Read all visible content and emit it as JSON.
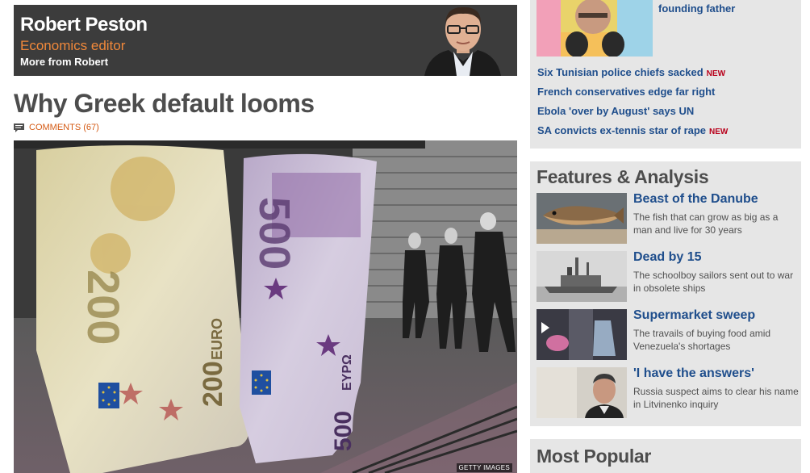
{
  "author": {
    "name": "Robert Peston",
    "role": "Economics editor",
    "more_label": "More from Robert"
  },
  "article": {
    "headline": "Why Greek default looms",
    "comments_label": "COMMENTS (67)",
    "image_credit": "GETTY IMAGES",
    "image_texts": {
      "note_left": "200",
      "note_right": "500",
      "euro": "EURO",
      "euro2": "EYPΩ"
    }
  },
  "sidebar": {
    "top_story": {
      "link": "founding father"
    },
    "news": [
      {
        "title": "Six Tunisian police chiefs sacked",
        "badge": "NEW"
      },
      {
        "title": "French conservatives edge far right",
        "badge": ""
      },
      {
        "title": "Ebola 'over by August' says UN",
        "badge": ""
      },
      {
        "title": "SA convicts ex-tennis star of rape",
        "badge": "NEW"
      }
    ],
    "features_title": "Features & Analysis",
    "features": [
      {
        "title": "Beast of the Danube",
        "desc": "The fish that can grow as big as a man and live for 30 years"
      },
      {
        "title": "Dead by 15",
        "desc": "The schoolboy sailors sent out to war in obsolete ships"
      },
      {
        "title": "Supermarket sweep",
        "desc": "The travails of buying food amid Venezuela's shortages"
      },
      {
        "title": "'I have the answers'",
        "desc": "Russia suspect aims to clear his name in Litvinenko inquiry"
      }
    ],
    "popular_title": "Most Popular"
  },
  "colors": {
    "link": "#1f4e8c",
    "accent": "#f0883a",
    "new_badge": "#b8001b",
    "panel": "#e6e6e6",
    "author_bg": "#3c3c3c"
  }
}
